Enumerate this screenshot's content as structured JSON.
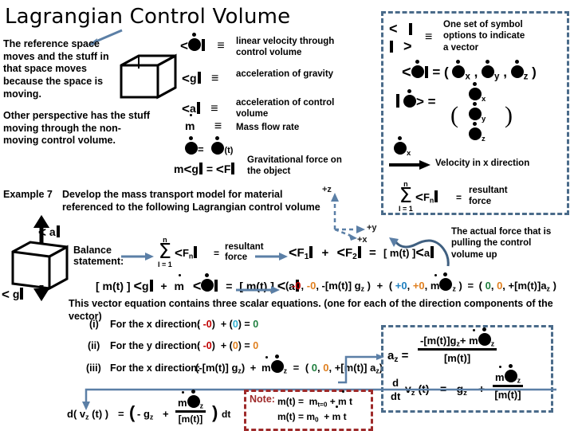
{
  "slide": {
    "title": "Lagrangian Control Volume",
    "left_paragraph_1": "The reference space moves and the stuff in that space moves because the space is moving.",
    "left_paragraph_2": "Other perspective has the stuff moving through the non-moving control volume.",
    "legend": [
      {
        "symbol_prefix": "<",
        "symbol_core": "v-dot-blob",
        "symbol_suffix": "|",
        "relation": "≡",
        "description": "linear velocity through control volume"
      },
      {
        "symbol_prefix": "<",
        "symbol_core": "g",
        "symbol_suffix": "|",
        "relation": "≡",
        "description": "acceleration of gravity"
      },
      {
        "symbol_prefix": "<",
        "symbol_core": "a",
        "symbol_suffix": "|",
        "relation": "≡",
        "description": "acceleration of control volume"
      },
      {
        "symbol_prefix": "",
        "symbol_core": "m-dot",
        "symbol_suffix": "",
        "relation": "≡",
        "description": "Mass flow rate"
      }
    ],
    "vdot_identity": "= (t)",
    "gravity_force_eq": "m <g | = <F |",
    "gravity_force_label": "Gravitational force on the object",
    "vector_notation_box": {
      "bra": "<",
      "bar": "|",
      "ket": ">",
      "relation": "≡",
      "note": "One set of symbol options to indicate a vector",
      "row_eq": "<v̇| = ( v̇x , v̇y , v̇z )",
      "column_eq": "| v̇ > = ( v̇x  v̇y  v̇z )",
      "sub_x": "x",
      "sub_y": "y",
      "sub_z": "z",
      "velocity_arrow_label": "Velocity in x direction",
      "sum_upper": "n",
      "sum_lower": "I = 1",
      "sum_body": "<F",
      "sum_body_sub": "n",
      "sum_result": "resultant force"
    },
    "example": {
      "label": "Example 7",
      "text": "Develop the mass transport model for material referenced to the following Lagrangian control volume"
    },
    "cv_diagram": {
      "up_label": "< a |",
      "down_label": "< g |"
    },
    "axes": {
      "z": "+z",
      "y": "+y",
      "x": "+x"
    },
    "balance": {
      "label_line1": "Balance",
      "label_line2": "statement:",
      "sum_upper": "n",
      "sum_lower": "I = 1",
      "sum_body": "<F",
      "sum_body_sub": "n",
      "sum_result_line1": "resultant",
      "sum_result_line2": "force",
      "right_eq": "<F1| + <F2| = [ m(t) ]< a |",
      "callout": "The actual force that is pulling the control volume up",
      "momentum_eq": "[ m(t) ] <g| + ṁ <v̇| = [ m(t) ] < a |",
      "component_eq": "( -0, -0, -[m(t)] gz ) + ( +0, +0, ṁ v̇z ) = ( 0, 0, +[m(t)]az )"
    },
    "scalar_intro": "This vector equation contains three scalar equations. (one for each of the direction components of the vector)",
    "scalar_lines": [
      {
        "index": "(i)",
        "text": "For the x direction:",
        "eq": "( -0 ) + ( 0 ) = 0"
      },
      {
        "index": "(ii)",
        "text": "For the y direction:",
        "eq": "( -0 ) + ( 0 ) = 0"
      },
      {
        "index": "(iii)",
        "text": "For the x direction:",
        "eq": "( -[m(t)] gz ) + ṁ v̇z = ( 0, 0, +[m(t)] az )"
      }
    ],
    "solution_box": {
      "a_symbol": "a",
      "a_sub": "z",
      "equals": "=",
      "numerator": "-[m(t)]gz+ ṁ v̇z",
      "denominator": "[m(t)]",
      "ddt_num": "d",
      "ddt_den": "dt",
      "lhs": "vz (t)",
      "eq2_equals": "=",
      "eq2_term1": "- gz",
      "eq2_plus": "+",
      "eq2_num": "ṁ v̇z",
      "eq2_den": "[m(t)]"
    },
    "final_eq": {
      "lhs": "d( vz (t) )",
      "equals": "=",
      "term1": "- gz",
      "plus": "+",
      "num": "ṁ v̇z",
      "den": "[m(t)]",
      "dt": "dt"
    },
    "note_box": {
      "label": "Note:",
      "line1": "m(t) =  mt=0 + ṁ t",
      "line2": "m(t) = m0  + ṁ t"
    },
    "colors": {
      "dash_blue": "#4a6b8a",
      "dash_red": "#9e2a2a",
      "arrow_blue": "#5b7fa6",
      "zero_red": "#c00000",
      "zero_orange": "#e08020",
      "zero_cyan": "#30b0d0",
      "zero_green": "#208040",
      "zero_blue": "#2080c0"
    }
  }
}
